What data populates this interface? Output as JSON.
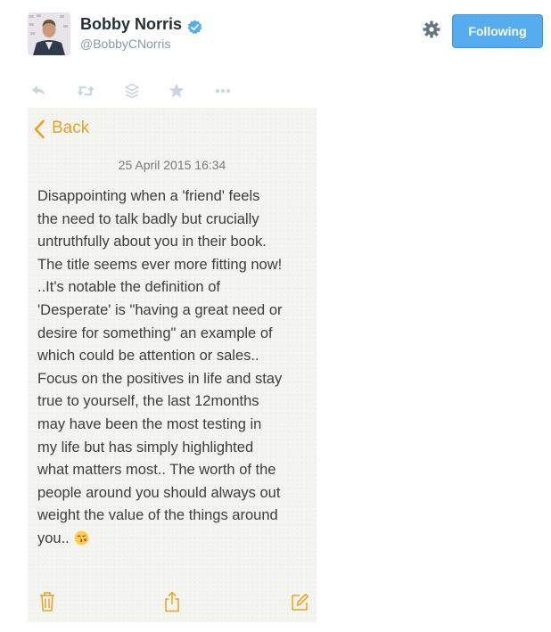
{
  "user": {
    "name": "Bobby Norris",
    "handle": "@BobbyCNorris",
    "verified": true
  },
  "header": {
    "follow_label": "Following",
    "settings_icon": "gear-icon"
  },
  "tweet_actions": {
    "icons": [
      "reply-icon",
      "retweet-icon",
      "buffer-icon",
      "favorite-icon",
      "more-icon"
    ]
  },
  "note": {
    "back_label": "Back",
    "date": "25 April 2015 16:34",
    "lines": [
      "Disappointing when a 'friend' feels",
      "the need to talk badly but crucially",
      "untruthfully about you in their book.",
      "The title seems ever more fitting now!",
      "..It's notable the definition of",
      "'Desperate' is \"having a great need or",
      "desire for something\" an example of",
      "which could be attention or sales..",
      "Focus on the positives in life and stay",
      "true to yourself, the last 12months",
      "may have been the most testing in",
      "my life but has simply highlighted",
      "what matters most.. The worth of the",
      "people around you should always out",
      "weight the value of the things around",
      "you.."
    ],
    "emoji": "kissing-face-emoji",
    "toolbar_icons": [
      "trash-icon",
      "share-icon",
      "compose-icon"
    ]
  },
  "colors": {
    "accent": "#55acee",
    "note_accent": "#e5a321",
    "note_background": "#f4f4f1",
    "text": "#292f33",
    "muted": "#8899a6"
  }
}
